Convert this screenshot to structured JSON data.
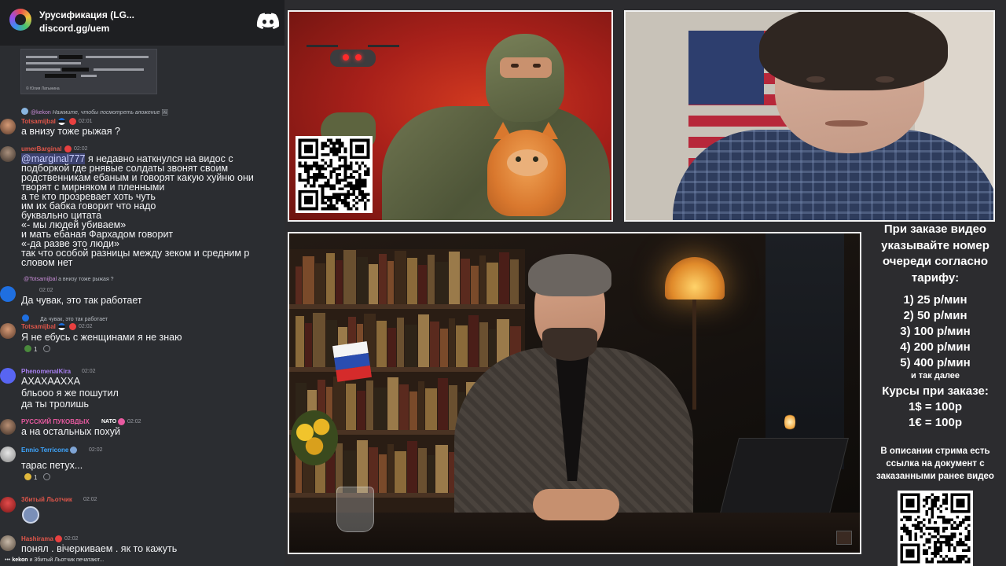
{
  "chat": {
    "server_name": "Урусификация (LG...",
    "server_invite": "discord.gg/uem",
    "image_caption": "© Юлия Латынина",
    "typing": {
      "user": "kekon",
      "rest": " и 3битый Льотчик печатают..."
    },
    "messages": [
      {
        "reply_user": "@kekon",
        "reply_text": "Нажмите, чтобы посмотреть вложение",
        "author": "Totsamijbal",
        "time": "02:01",
        "lines": [
          "а внизу тоже рыжая ?"
        ]
      },
      {
        "author": "umerBarginal",
        "time": "02:02",
        "mention": "@marginal777",
        "first_line_rest": " я недавно наткнулся на видос с",
        "lines": [
          "подборкой где рнявые солдаты звонят своим",
          "родственникам ебаным и говорят какую хуйню они",
          "творят с мирняком и пленными",
          "а те кто прозревает хоть чуть",
          "им их бабка говорит что надо",
          "буквально цитата",
          "«- мы людей убиваем»",
          "и мать ебаная Фархадом говорит",
          "«-да разве это люди»",
          "так что особой разницы между зеком и средним р",
          "словом нет"
        ]
      },
      {
        "reply_user": "@Totsamijbal",
        "reply_text": "а внизу тоже рыжая ?",
        "time": "02:02",
        "lines": [
          "Да чувак, это так работает"
        ]
      },
      {
        "reply_text": "Да чувак, это так работает",
        "author": "Totsamijbal",
        "time": "02:02",
        "lines": [
          "Я не ебусь с женщинами я не знаю"
        ],
        "reaction_count": "1"
      },
      {
        "author": "PhenomenalKira",
        "time": "02:02",
        "lines": [
          "АХАХААХХА",
          "бльооо я же пошутил",
          "да ты тролишь"
        ]
      },
      {
        "author": "РУССКИЙ ПУКОВДЫХ",
        "tag": "NATO",
        "time": "02:02",
        "lines": [
          "а на остальных похуй"
        ]
      },
      {
        "author": "Ennio Terricone",
        "time": "02:02",
        "lines": [
          "тарас петух..."
        ],
        "reaction_count": "1"
      },
      {
        "author": "3битый Льотчик",
        "time": "02:02",
        "lines": []
      },
      {
        "author": "Hashirama",
        "time": "02:02",
        "lines": [
          "понял . вічеркиваем . як то кажуть"
        ]
      }
    ]
  },
  "info": {
    "title": "При заказе видео указывайте номер очереди согласно тарифу:",
    "prices": [
      "1) 25 р/мин",
      "2) 50 р/мин",
      "3) 100 р/мин",
      "4) 200 р/мин",
      "5) 400 р/мин"
    ],
    "prices_more": "и так далее",
    "rates_title": "Курсы при заказе:",
    "rates": [
      "1$ = 100р",
      "1€ = 100р"
    ],
    "note": "В описании стрима есть ссылка на документ с заказанными ранее видео"
  },
  "colors": {
    "chat_bg": "#2b2d31",
    "chat_header_bg": "#1e1f22",
    "author_red": "#e0564a",
    "author_blue": "#3ea6ff",
    "author_purple": "#a77ff0",
    "author_pink": "#e85aa0",
    "discord_blurple": "#5865f2"
  }
}
